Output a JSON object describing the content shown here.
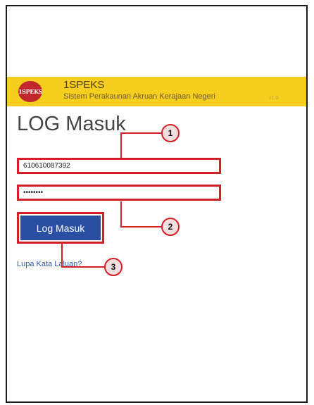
{
  "app": {
    "logo_text": "1SPEKS",
    "name": "1SPEKS",
    "subtitle": "Sistem Perakaunan Akruan Kerajaan Negeri",
    "version": "v1.0"
  },
  "login": {
    "title": "LOG Masuk",
    "username_value": "610610087392",
    "password_value": "••••••••",
    "button_label": "Log Masuk",
    "forgot_link": "Lupa Kata Laluan?"
  },
  "callouts": [
    {
      "number": "1",
      "target": "username-field"
    },
    {
      "number": "2",
      "target": "password-field"
    },
    {
      "number": "3",
      "target": "login-button"
    }
  ],
  "colors": {
    "header_bg": "#f6ce1e",
    "button_bg": "#2a4fa2",
    "highlight": "#d41f26"
  }
}
